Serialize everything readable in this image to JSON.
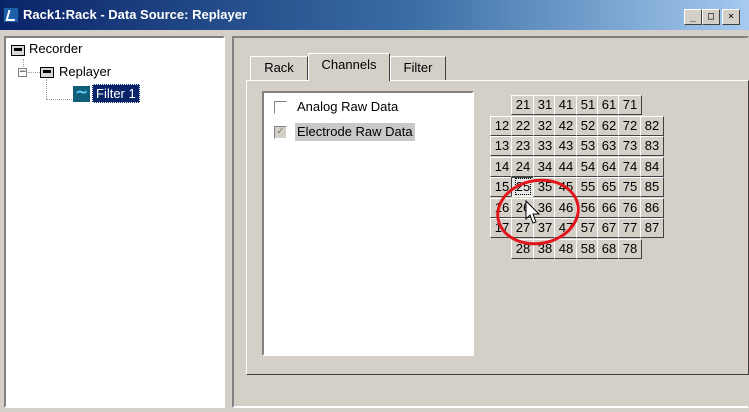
{
  "window": {
    "title": "Rack1:Rack - Data Source: Replayer"
  },
  "title_buttons": {
    "minimize": "_",
    "maximize": "□",
    "close": "×"
  },
  "tree": {
    "items": [
      {
        "label": "Recorder"
      },
      {
        "label": "Replayer",
        "expander": "−"
      },
      {
        "label": "Filter 1",
        "selected": true
      }
    ]
  },
  "tabs": [
    {
      "label": "Rack"
    },
    {
      "label": "Channels",
      "active": true
    },
    {
      "label": "Filter"
    }
  ],
  "data_types": [
    {
      "label": "Analog Raw Data",
      "checked": false
    },
    {
      "label": "Electrode Raw Data",
      "checked": true,
      "check_mark": "✓"
    }
  ],
  "channels": [
    [
      null,
      "21",
      "31",
      "41",
      "51",
      "61",
      "71",
      null
    ],
    [
      "12",
      "22",
      "32",
      "42",
      "52",
      "62",
      "72",
      "82"
    ],
    [
      "13",
      "23",
      "33",
      "43",
      "53",
      "63",
      "73",
      "83"
    ],
    [
      "14",
      "24",
      "34",
      "44",
      "54",
      "64",
      "74",
      "84"
    ],
    [
      "15",
      "25",
      "35",
      "45",
      "55",
      "65",
      "75",
      "85"
    ],
    [
      "16",
      "26",
      "36",
      "46",
      "56",
      "66",
      "76",
      "86"
    ],
    [
      "17",
      "27",
      "37",
      "47",
      "57",
      "67",
      "77",
      "87"
    ],
    [
      null,
      "28",
      "38",
      "48",
      "58",
      "68",
      "78",
      null
    ]
  ],
  "pressed_channel": "25",
  "colors": {
    "annotation": "#e0161b",
    "title_bar": "#0a246a",
    "selection": "#0a246a"
  }
}
